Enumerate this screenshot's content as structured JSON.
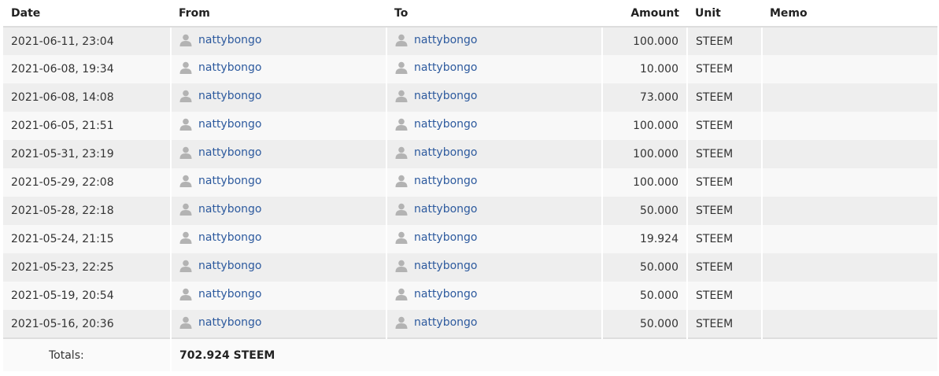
{
  "table": {
    "headers": {
      "date": "Date",
      "from": "From",
      "to": "To",
      "amount": "Amount",
      "unit": "Unit",
      "memo": "Memo"
    },
    "rows": [
      {
        "date": "2021-06-11, 23:04",
        "from": "nattybongo",
        "to": "nattybongo",
        "amount": "100.000",
        "unit": "STEEM",
        "memo": ""
      },
      {
        "date": "2021-06-08, 19:34",
        "from": "nattybongo",
        "to": "nattybongo",
        "amount": "10.000",
        "unit": "STEEM",
        "memo": ""
      },
      {
        "date": "2021-06-08, 14:08",
        "from": "nattybongo",
        "to": "nattybongo",
        "amount": "73.000",
        "unit": "STEEM",
        "memo": ""
      },
      {
        "date": "2021-06-05, 21:51",
        "from": "nattybongo",
        "to": "nattybongo",
        "amount": "100.000",
        "unit": "STEEM",
        "memo": ""
      },
      {
        "date": "2021-05-31, 23:19",
        "from": "nattybongo",
        "to": "nattybongo",
        "amount": "100.000",
        "unit": "STEEM",
        "memo": ""
      },
      {
        "date": "2021-05-29, 22:08",
        "from": "nattybongo",
        "to": "nattybongo",
        "amount": "100.000",
        "unit": "STEEM",
        "memo": ""
      },
      {
        "date": "2021-05-28, 22:18",
        "from": "nattybongo",
        "to": "nattybongo",
        "amount": "50.000",
        "unit": "STEEM",
        "memo": ""
      },
      {
        "date": "2021-05-24, 21:15",
        "from": "nattybongo",
        "to": "nattybongo",
        "amount": "19.924",
        "unit": "STEEM",
        "memo": ""
      },
      {
        "date": "2021-05-23, 22:25",
        "from": "nattybongo",
        "to": "nattybongo",
        "amount": "50.000",
        "unit": "STEEM",
        "memo": ""
      },
      {
        "date": "2021-05-19, 20:54",
        "from": "nattybongo",
        "to": "nattybongo",
        "amount": "50.000",
        "unit": "STEEM",
        "memo": ""
      },
      {
        "date": "2021-05-16, 20:36",
        "from": "nattybongo",
        "to": "nattybongo",
        "amount": "50.000",
        "unit": "STEEM",
        "memo": ""
      }
    ],
    "totals": {
      "label": "Totals:",
      "value": "702.924 STEEM"
    }
  },
  "icons": {
    "user": "user-avatar-icon"
  },
  "colors": {
    "link": "#2d5a9e",
    "row_odd": "#eeeeee",
    "row_even": "#f8f8f8",
    "icon": "#b3b3b3"
  }
}
